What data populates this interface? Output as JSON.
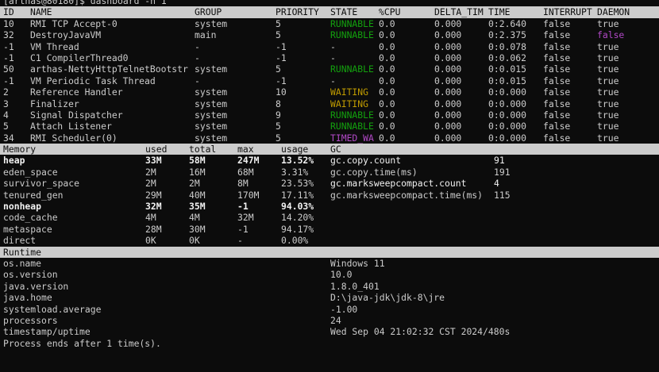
{
  "prompt": "[arthas@80180]$ dashboard -n 1",
  "thread_header": [
    "ID",
    "NAME",
    "GROUP",
    "PRIORITY",
    "STATE",
    "%CPU",
    "DELTA_TIM",
    "TIME",
    "INTERRUPT",
    "DAEMON"
  ],
  "threads": [
    {
      "id": "10",
      "name": "RMI TCP Accept-0",
      "group": "system",
      "priority": "5",
      "state": "RUNNABLE",
      "cpu": "0.0",
      "delta": "0.000",
      "time": "0:2.640",
      "interrupt": "false",
      "daemon": "true"
    },
    {
      "id": "32",
      "name": "DestroyJavaVM",
      "group": "main",
      "priority": "5",
      "state": "RUNNABLE",
      "cpu": "0.0",
      "delta": "0.000",
      "time": "0:2.375",
      "interrupt": "false",
      "daemon": "false"
    },
    {
      "id": "-1",
      "name": "VM Thread",
      "group": "-",
      "priority": "-1",
      "state": "-",
      "cpu": "0.0",
      "delta": "0.000",
      "time": "0:0.078",
      "interrupt": "false",
      "daemon": "true"
    },
    {
      "id": "-1",
      "name": "C1 CompilerThread0",
      "group": "-",
      "priority": "-1",
      "state": "-",
      "cpu": "0.0",
      "delta": "0.000",
      "time": "0:0.062",
      "interrupt": "false",
      "daemon": "true"
    },
    {
      "id": "50",
      "name": "arthas-NettyHttpTelnetBootstr",
      "group": "system",
      "priority": "5",
      "state": "RUNNABLE",
      "cpu": "0.0",
      "delta": "0.000",
      "time": "0:0.015",
      "interrupt": "false",
      "daemon": "true"
    },
    {
      "id": "-1",
      "name": "VM Periodic Task Thread",
      "group": "-",
      "priority": "-1",
      "state": "-",
      "cpu": "0.0",
      "delta": "0.000",
      "time": "0:0.015",
      "interrupt": "false",
      "daemon": "true"
    },
    {
      "id": "2",
      "name": "Reference Handler",
      "group": "system",
      "priority": "10",
      "state": "WAITING",
      "cpu": "0.0",
      "delta": "0.000",
      "time": "0:0.000",
      "interrupt": "false",
      "daemon": "true"
    },
    {
      "id": "3",
      "name": "Finalizer",
      "group": "system",
      "priority": "8",
      "state": "WAITING",
      "cpu": "0.0",
      "delta": "0.000",
      "time": "0:0.000",
      "interrupt": "false",
      "daemon": "true"
    },
    {
      "id": "4",
      "name": "Signal Dispatcher",
      "group": "system",
      "priority": "9",
      "state": "RUNNABLE",
      "cpu": "0.0",
      "delta": "0.000",
      "time": "0:0.000",
      "interrupt": "false",
      "daemon": "true"
    },
    {
      "id": "5",
      "name": "Attach Listener",
      "group": "system",
      "priority": "5",
      "state": "RUNNABLE",
      "cpu": "0.0",
      "delta": "0.000",
      "time": "0:0.000",
      "interrupt": "false",
      "daemon": "true"
    },
    {
      "id": "34",
      "name": "RMI Scheduler(0)",
      "group": "system",
      "priority": "5",
      "state": "TIMED_WA",
      "cpu": "0.0",
      "delta": "0.000",
      "time": "0:0.000",
      "interrupt": "false",
      "daemon": "true"
    }
  ],
  "memory_header": [
    "Memory",
    "used",
    "total",
    "max",
    "usage",
    "GC"
  ],
  "memory": [
    {
      "name": "heap",
      "used": "33M",
      "total": "58M",
      "max": "247M",
      "usage": "13.52%",
      "bold": true
    },
    {
      "name": "eden_space",
      "used": "2M",
      "total": "16M",
      "max": "68M",
      "usage": "3.31%",
      "bold": false
    },
    {
      "name": "survivor_space",
      "used": "2M",
      "total": "2M",
      "max": "8M",
      "usage": "23.53%",
      "bold": false
    },
    {
      "name": "tenured_gen",
      "used": "29M",
      "total": "40M",
      "max": "170M",
      "usage": "17.11%",
      "bold": false
    },
    {
      "name": "nonheap",
      "used": "32M",
      "total": "35M",
      "max": "-1",
      "usage": "94.03%",
      "bold": true
    },
    {
      "name": "code_cache",
      "used": "4M",
      "total": "4M",
      "max": "32M",
      "usage": "14.20%",
      "bold": false
    },
    {
      "name": "metaspace",
      "used": "28M",
      "total": "30M",
      "max": "-1",
      "usage": "94.17%",
      "bold": false
    },
    {
      "name": "direct",
      "used": "0K",
      "total": "0K",
      "max": "-",
      "usage": "0.00%",
      "bold": false
    }
  ],
  "gc": [
    {
      "name": "gc.copy.count",
      "value": "91",
      "bold": true
    },
    {
      "name": "gc.copy.time(ms)",
      "value": "191",
      "bold": false
    },
    {
      "name": "gc.marksweepcompact.count",
      "value": "4",
      "bold": true
    },
    {
      "name": "gc.marksweepcompact.time(ms)",
      "value": "115",
      "bold": false
    }
  ],
  "runtime_header": "Runtime",
  "runtime": [
    {
      "key": "os.name",
      "value": "Windows 11"
    },
    {
      "key": "os.version",
      "value": "10.0"
    },
    {
      "key": "java.version",
      "value": "1.8.0_401"
    },
    {
      "key": "java.home",
      "value": "D:\\java-jdk\\jdk-8\\jre"
    },
    {
      "key": "systemload.average",
      "value": "-1.00"
    },
    {
      "key": "processors",
      "value": "24"
    },
    {
      "key": "timestamp/uptime",
      "value": "Wed Sep 04 21:02:32 CST 2024/480s"
    }
  ],
  "footer": "Process ends after 1 time(s).",
  "colors": {
    "background": "#0c0c0c",
    "text": "#cccccc",
    "header_bg": "#cccccc",
    "runnable": "#13a10e",
    "waiting": "#c19c00",
    "timed_waiting": "#b148c6",
    "daemon_false": "#b148c6"
  }
}
